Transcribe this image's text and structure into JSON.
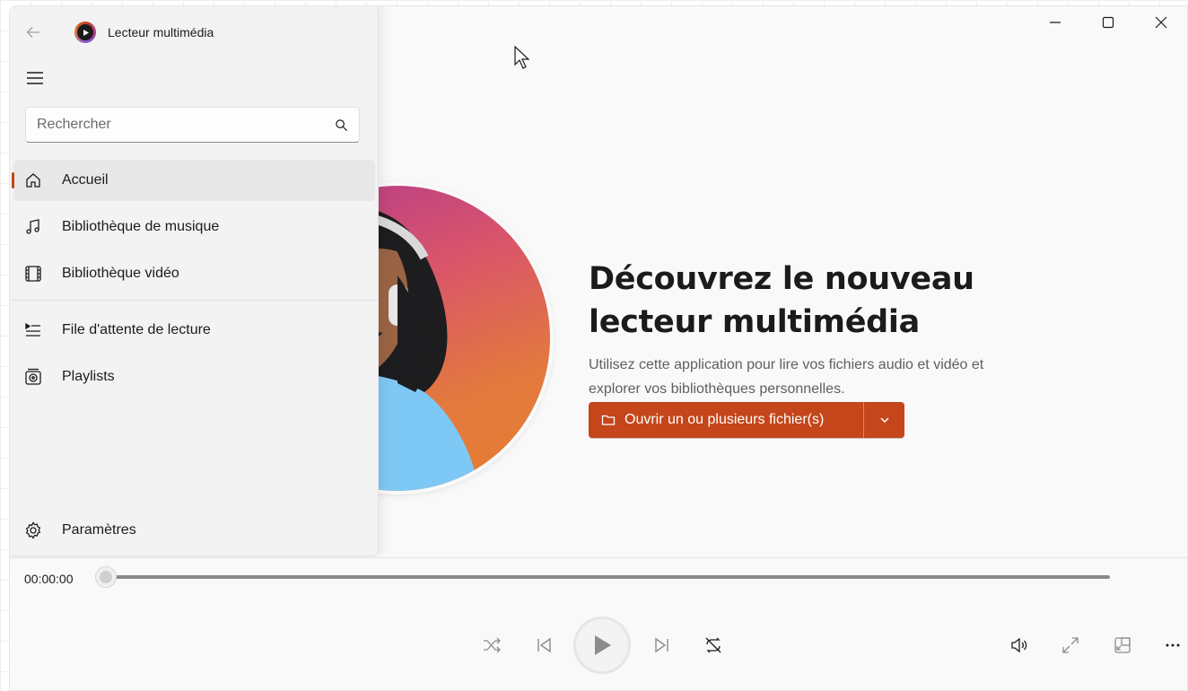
{
  "window": {
    "app_title": "Lecteur multimédia",
    "controls": [
      "minimize-icon",
      "maximize-icon",
      "close-icon"
    ]
  },
  "sidebar": {
    "search": {
      "placeholder": "Rechercher",
      "value": ""
    },
    "items": [
      {
        "label": "Accueil",
        "icon": "home-icon",
        "active": true
      },
      {
        "label": "Bibliothèque de musique",
        "icon": "music-note-icon"
      },
      {
        "label": "Bibliothèque vidéo",
        "icon": "film-icon"
      },
      {
        "label": "File d'attente de lecture",
        "icon": "queue-icon"
      },
      {
        "label": "Playlists",
        "icon": "playlist-icon"
      }
    ],
    "settings_label": "Paramètres"
  },
  "hero": {
    "title": "Découvrez le nouveau lecteur multimédia",
    "subtitle": "Utilisez cette application pour lire vos fichiers audio et vidéo et explorer vos bibliothèques personnelles.",
    "open_button_label": "Ouvrir un ou plusieurs fichier(s)"
  },
  "player": {
    "elapsed": "00:00:00",
    "progress": 0
  },
  "colors": {
    "accent": "#c4461a",
    "background": "#f9f9f9",
    "sidebar": "#f3f3f3"
  }
}
